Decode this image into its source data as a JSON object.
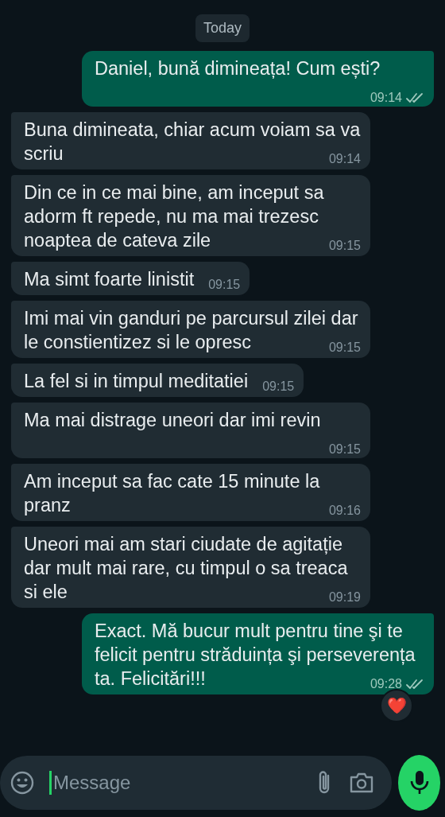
{
  "date_chip": "Today",
  "messages": [
    {
      "kind": "out",
      "text": "Daniel, bună dimineața! Cum ești?",
      "time": "09:14",
      "read": false
    },
    {
      "kind": "in",
      "text": "Buna dimineata, chiar acum voiam sa va scriu",
      "time": "09:14"
    },
    {
      "kind": "in",
      "text": "Din ce in ce mai bine, am inceput sa adorm ft repede, nu ma mai trezesc noaptea de cateva zile",
      "time": "09:15"
    },
    {
      "kind": "in",
      "text": "Ma simt foarte linistit",
      "time": "09:15"
    },
    {
      "kind": "in",
      "text": "Imi mai vin ganduri pe parcursul zilei dar le constientizez si le opresc",
      "time": "09:15"
    },
    {
      "kind": "in",
      "text": "La fel si in timpul meditatiei",
      "time": "09:15"
    },
    {
      "kind": "in",
      "text": "Ma mai distrage uneori dar imi revin",
      "time": "09:15"
    },
    {
      "kind": "in",
      "text": "Am inceput sa fac cate 15 minute la pranz",
      "time": "09:16"
    },
    {
      "kind": "in",
      "text": "Uneori mai am stari ciudate de agitație dar mult mai rare, cu timpul o sa treaca si ele",
      "time": "09:19"
    },
    {
      "kind": "out",
      "text": "Exact. Mă bucur mult pentru tine şi te felicit pentru străduința şi perseverența ta. Felicitări!!!",
      "time": "09:28",
      "read": false,
      "reaction": "❤️"
    }
  ],
  "composer": {
    "placeholder": "Message"
  }
}
